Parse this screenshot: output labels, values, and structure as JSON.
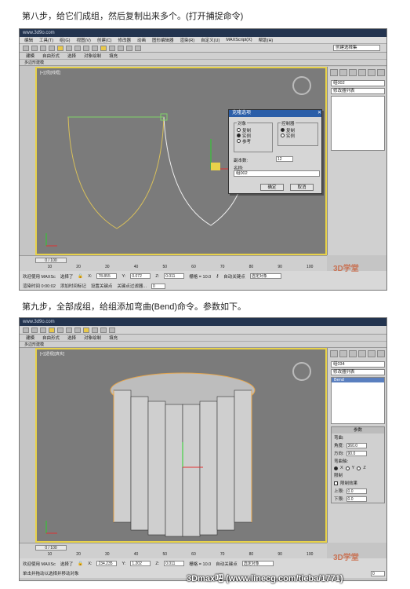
{
  "step8_caption": "第八步，给它们成组，然后复制出来多个。(打开捕捉命令)",
  "step9_caption": "第九步，全部成组，给组添加弯曲(Bend)命令。参数如下。",
  "shot1": {
    "title_brand": "www.3d9o.com",
    "menus": [
      "编辑",
      "工具(T)",
      "组(G)",
      "视图(V)",
      "创建(C)",
      "修改器",
      "动画",
      "图形编辑器",
      "渲染(R)",
      "自定义(U)",
      "MAXScript(X)",
      "帮助(H)"
    ],
    "search_placeholder": "创建选择集",
    "ribbon_tabs": [
      "建模",
      "自由形式",
      "选择",
      "对象绘制",
      "填充"
    ],
    "subbar_label": "多边形建模",
    "viewport_label": "[+][顶][线框]",
    "object_name": "组002",
    "modifier_list": "修改器列表",
    "dialog": {
      "title": "克隆选项",
      "object_group": "对象",
      "object_options": [
        "复制",
        "实例",
        "参考"
      ],
      "object_selected": 1,
      "controller_group": "控制器",
      "controller_options": [
        "复制",
        "实例"
      ],
      "controller_selected": 0,
      "copies_label": "副本数:",
      "copies_value": "12",
      "name_label": "名称:",
      "name_value": "组002",
      "ok": "确定",
      "cancel": "取消"
    },
    "time_counter": "0 / 100",
    "ruler": [
      "10",
      "20",
      "30",
      "40",
      "50",
      "60",
      "70",
      "80",
      "90",
      "100"
    ],
    "status": {
      "selected": "选择了",
      "x_label": "X:",
      "x_value": "78.855",
      "y_label": "Y:",
      "y_value": "0.072",
      "z_label": "Z:",
      "z_value": "0.011",
      "grid": "栅格 = 10.0",
      "autokey": "自动关键点",
      "selection_mode": "选定对象",
      "welcome": "欢迎使用 MAXSc",
      "render_time": "渲染时间 0:00:02",
      "add_time_tag": "添加时间标记",
      "setkey": "设置关键点",
      "keyfilter": "关键点过滤器...",
      "frame": "0"
    },
    "watermark": "3D学堂"
  },
  "shot2": {
    "title_brand": "www.3d9o.com",
    "ribbon_tabs": [
      "建模",
      "自由形式",
      "选择",
      "对象绘制",
      "填充"
    ],
    "subbar_label": "多边形建模",
    "viewport_label": "[+][透视][真实]",
    "object_name": "组034",
    "modifier_list": "修改器列表",
    "stack_item": "Bend",
    "parameters_title": "参数",
    "bend_label": "弯曲:",
    "angle_label": "角度:",
    "angle_value": "360.0",
    "direction_label": "方向:",
    "direction_value": "90.0",
    "axis_label": "弯曲轴:",
    "axes": [
      "X",
      "Y",
      "Z"
    ],
    "axis_selected": 0,
    "limits_label": "限制",
    "limit_effect_label": "限制效果",
    "upper_label": "上限:",
    "upper_value": "0.0",
    "lower_label": "下限:",
    "lower_value": "0.0",
    "time_counter": "0 / 100",
    "ruler": [
      "10",
      "20",
      "30",
      "40",
      "50",
      "60",
      "70",
      "80",
      "90",
      "100"
    ],
    "status": {
      "selected": "选择了",
      "x_label": "X:",
      "x_value": "234.235",
      "y_label": "Y:",
      "y_value": "1.202",
      "z_label": "Z:",
      "z_value": "0.011",
      "grid": "栅格 = 10.0",
      "autokey": "自动关键点",
      "selection_mode": "选定对象",
      "welcome": "欢迎使用 MAXSc",
      "prompt": "单击并拖动以选择并移动对象",
      "frame": "0"
    },
    "watermark": "3D学堂"
  },
  "footer_credit": "3Dmax吧 (www.linecg.com/tieba/1771)",
  "colors": {
    "selection": "#e8d24a",
    "title_bar": "#23344f",
    "dialog_title": "#2b5ea8",
    "viewport": "#7b7b7b",
    "accent_orange": "#c9572f"
  }
}
